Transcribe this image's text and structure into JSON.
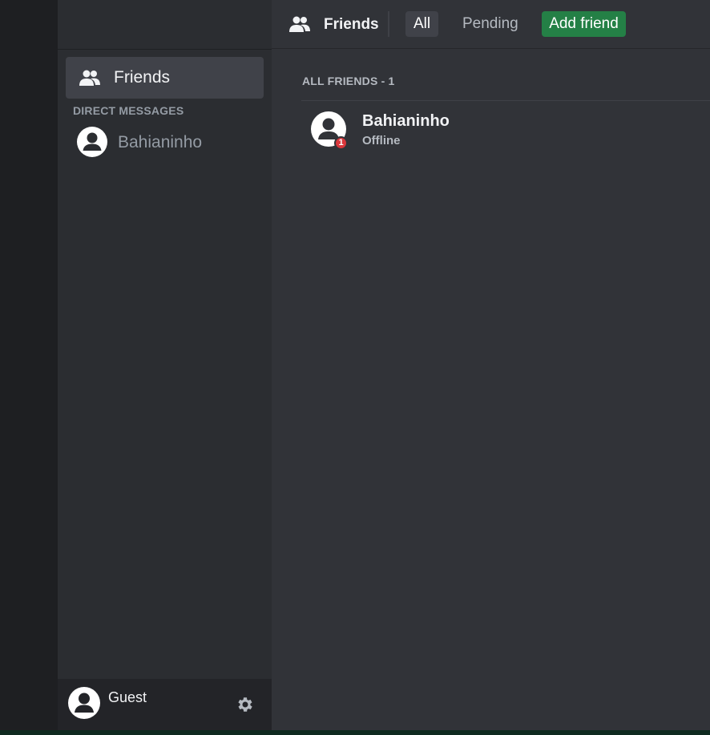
{
  "colors": {
    "accent_green": "#248046",
    "badge_red": "#da373c",
    "sidebar_bg": "#2b2d31",
    "main_bg": "#313338"
  },
  "header": {
    "icon": "friends-icon",
    "title": "Friends",
    "tabs": {
      "all": "All",
      "pending": "Pending",
      "add_friend": "Add friend"
    }
  },
  "sidebar": {
    "friends_label": "Friends",
    "friends_icon": "friends-icon",
    "dm_header": "DIRECT MESSAGES",
    "direct_messages": [
      {
        "name": "Bahianinho",
        "icon": "avatar-icon"
      }
    ]
  },
  "friends_list": {
    "header": "ALL FRIENDS - 1",
    "friends": [
      {
        "name": "Bahianinho",
        "status": "Offline",
        "badge": "1"
      }
    ]
  },
  "user_panel": {
    "username": "Guest",
    "settings_icon": "gear-icon"
  }
}
